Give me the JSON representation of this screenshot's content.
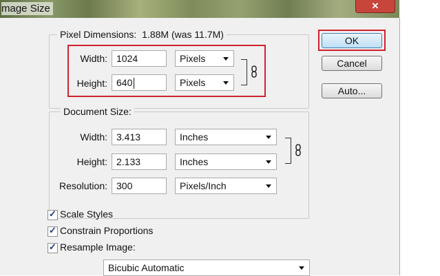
{
  "window": {
    "title": "mage Size",
    "close_glyph": "✕"
  },
  "pixel_dimensions": {
    "legend": "Pixel Dimensions:",
    "summary": "1.88M (was 11.7M)",
    "width_label": "Width:",
    "width_value": "1024",
    "width_unit": "Pixels",
    "height_label": "Height:",
    "height_value": "640",
    "height_unit": "Pixels",
    "link_icon": "chain-link-icon"
  },
  "document_size": {
    "legend": "Document Size:",
    "width_label": "Width:",
    "width_value": "3.413",
    "width_unit": "Inches",
    "height_label": "Height:",
    "height_value": "2.133",
    "height_unit": "Inches",
    "resolution_label": "Resolution:",
    "resolution_value": "300",
    "resolution_unit": "Pixels/Inch",
    "link_icon": "chain-link-icon"
  },
  "options": {
    "scale_styles": {
      "label": "Scale Styles",
      "checked": true
    },
    "constrain_proportions": {
      "label": "Constrain Proportions",
      "checked": true
    },
    "resample_image": {
      "label": "Resample Image:",
      "checked": true
    },
    "resample_method": "Bicubic Automatic"
  },
  "buttons": {
    "ok": "OK",
    "cancel": "Cancel",
    "auto": "Auto..."
  },
  "colors": {
    "highlight": "#d0202e",
    "dialog_bg": "#f0f0f0"
  }
}
